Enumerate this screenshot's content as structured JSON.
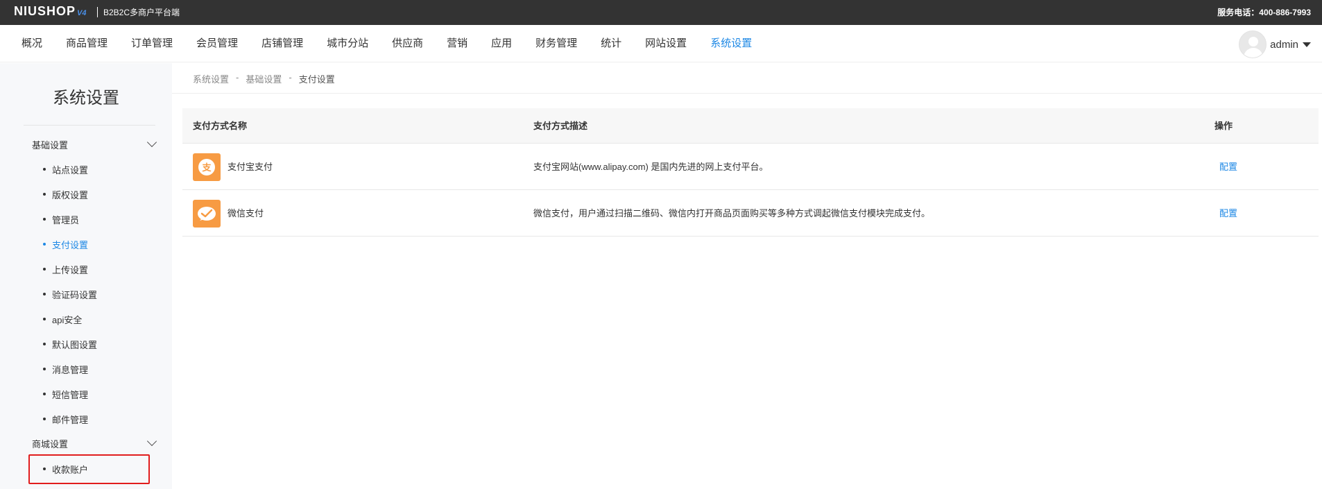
{
  "topbar": {
    "logo": "NIUSHOP",
    "logo_version": "V4",
    "platform": "B2B2C多商户平台端",
    "service_phone": "服务电话：400-886-7993"
  },
  "nav": {
    "items": [
      {
        "label": "概况",
        "active": false
      },
      {
        "label": "商品管理",
        "active": false
      },
      {
        "label": "订单管理",
        "active": false
      },
      {
        "label": "会员管理",
        "active": false
      },
      {
        "label": "店铺管理",
        "active": false
      },
      {
        "label": "城市分站",
        "active": false
      },
      {
        "label": "供应商",
        "active": false
      },
      {
        "label": "营销",
        "active": false
      },
      {
        "label": "应用",
        "active": false
      },
      {
        "label": "财务管理",
        "active": false
      },
      {
        "label": "统计",
        "active": false
      },
      {
        "label": "网站设置",
        "active": false
      },
      {
        "label": "系统设置",
        "active": true
      }
    ],
    "user": {
      "name": "admin",
      "avatar_icon": "user-avatar-icon"
    }
  },
  "sidebar": {
    "title": "系统设置",
    "groups": [
      {
        "label": "基础设置",
        "items": [
          {
            "label": "站点设置"
          },
          {
            "label": "版权设置"
          },
          {
            "label": "管理员"
          },
          {
            "label": "支付设置",
            "active": true
          },
          {
            "label": "上传设置"
          },
          {
            "label": "验证码设置"
          },
          {
            "label": "api安全"
          },
          {
            "label": "默认图设置"
          },
          {
            "label": "消息管理"
          },
          {
            "label": "短信管理"
          },
          {
            "label": "邮件管理"
          }
        ]
      },
      {
        "label": "商城设置",
        "items": [
          {
            "label": "收款账户",
            "highlighted": true
          }
        ]
      }
    ]
  },
  "breadcrumb": [
    "系统设置",
    "基础设置",
    "支付设置"
  ],
  "breadcrumb_sep": "-",
  "table": {
    "headers": {
      "name": "支付方式名称",
      "desc": "支付方式描述",
      "op": "操作"
    },
    "rows": [
      {
        "icon": "alipay-icon",
        "name": "支付宝支付",
        "desc": "支付宝网站(www.alipay.com) 是国内先进的网上支付平台。",
        "op": "配置"
      },
      {
        "icon": "wechat-pay-icon",
        "name": "微信支付",
        "desc": "微信支付，用户通过扫描二维码、微信内打开商品页面购买等多种方式调起微信支付模块完成支付。",
        "op": "配置"
      }
    ]
  },
  "colors": {
    "accent": "#1e88e5",
    "topbar": "#333333",
    "icon_bg": "#f79b43",
    "highlight": "#e11d1d"
  }
}
